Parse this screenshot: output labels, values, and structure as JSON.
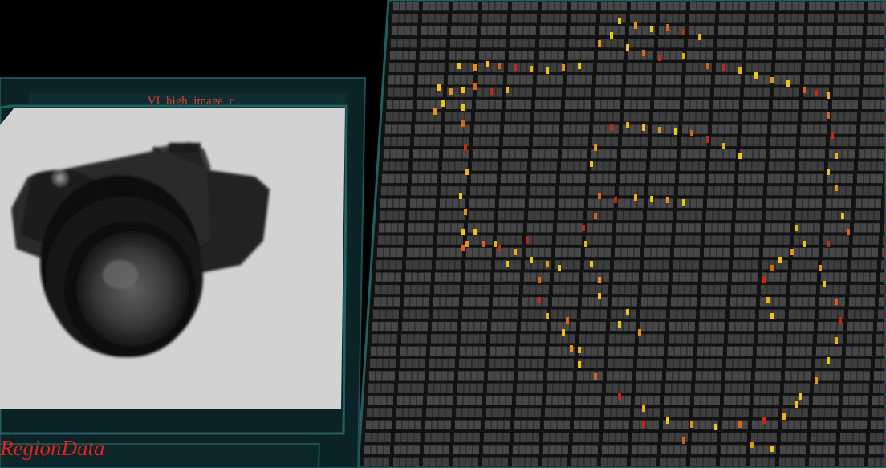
{
  "viewer": {
    "panel_title": "VI_high_image_r",
    "region_label": "RegionData",
    "image_subject": "camera",
    "colors": {
      "background": "#000000",
      "frame": "#0b2326",
      "frame_border": "#1e5a5a",
      "grid_border": "#1f5f5e",
      "cell": "#4a4a4a",
      "cell_dim": "#3a3a3a",
      "active_yellow": "#f2c417",
      "active_orange": "#e8821a",
      "active_red": "#c42a12",
      "connector": "#a27bc0",
      "title_text": "#d8413a"
    },
    "grid": {
      "description": "neuron column grid showing active units",
      "rows": 38,
      "cols": 44
    }
  }
}
